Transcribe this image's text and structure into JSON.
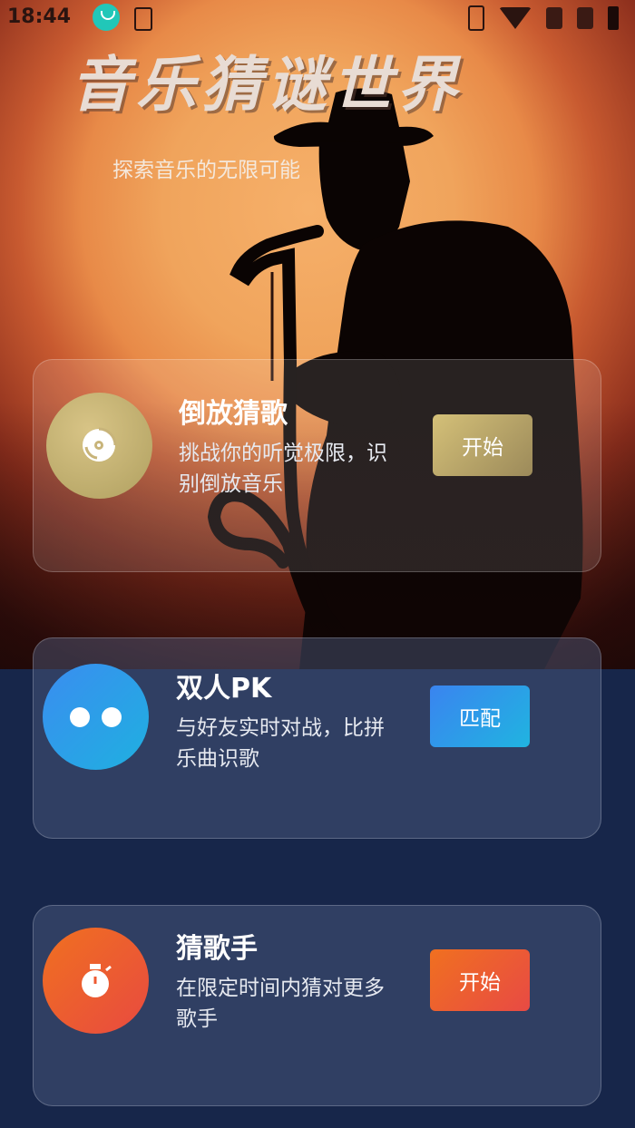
{
  "status_bar": {
    "time": "18:44",
    "app_icon": "app-notification-icon",
    "icons": [
      "vibrate-icon",
      "wifi-icon",
      "sim1-icon",
      "sim2-icon",
      "battery-icon"
    ]
  },
  "header": {
    "title": "音乐猜谜世界",
    "subtitle": "探索音乐的无限可能"
  },
  "modes": [
    {
      "title": "倒放猜歌",
      "description": "挑战你的听觉极限，识别倒放音乐",
      "button": "开始",
      "icon": "vinyl-disc-icon",
      "accent": "#c9b676"
    },
    {
      "title": "双人PK",
      "description": "与好友实时对战，比拼乐曲识歌",
      "button": "匹配",
      "icon": "two-players-icon",
      "accent": "#2f9be8"
    },
    {
      "title": "猜歌手",
      "description": "在限定时间内猜对更多歌手",
      "button": "开始",
      "icon": "stopwatch-icon",
      "accent": "#ee5a32"
    }
  ],
  "colors": {
    "page_background": "#17264a",
    "hero_glow": "#f0a45c"
  }
}
